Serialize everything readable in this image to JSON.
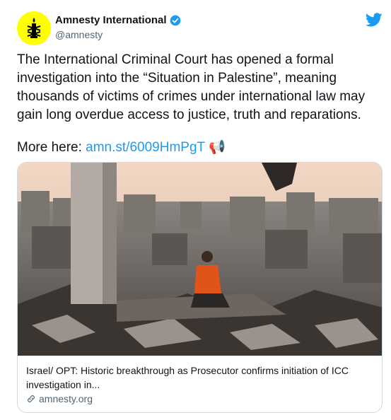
{
  "author": {
    "display_name": "Amnesty International",
    "handle": "@amnesty",
    "verified": true,
    "avatar_color": "#ffff00"
  },
  "tweet": {
    "text": "The International Criminal Court has opened a formal investigation into the “Situation in Palestine”, meaning thousands of victims of crimes under international law may gain long overdue access to justice, truth and reparations.",
    "more_prefix": "More here: ",
    "link_text": "amn.st/6009HmPgT",
    "emoji": "📢"
  },
  "card": {
    "title": "Israel/ OPT: Historic breakthrough as Prosecutor confirms initiation of ICC investigation in...",
    "domain": "amnesty.org"
  },
  "icons": {
    "bird": "twitter-bird-icon",
    "verified": "verified-badge-icon",
    "link": "link-icon",
    "logo": "amnesty-candle-logo-icon"
  },
  "colors": {
    "link": "#1d9bf0",
    "bird": "#1d9bf0",
    "border": "#cfd9de"
  }
}
